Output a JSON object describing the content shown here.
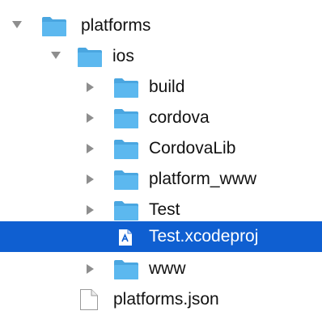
{
  "tree": {
    "items": [
      {
        "label": "platforms",
        "type": "folder",
        "expanded": true
      },
      {
        "label": "ios",
        "type": "folder",
        "expanded": true
      },
      {
        "label": "build",
        "type": "folder",
        "expanded": false
      },
      {
        "label": "cordova",
        "type": "folder",
        "expanded": false
      },
      {
        "label": "CordovaLib",
        "type": "folder",
        "expanded": false
      },
      {
        "label": "platform_www",
        "type": "folder",
        "expanded": false
      },
      {
        "label": "Test",
        "type": "folder",
        "expanded": false
      },
      {
        "label": "Test.xcodeproj",
        "type": "xcodeproj",
        "selected": true
      },
      {
        "label": "www",
        "type": "folder",
        "expanded": false
      },
      {
        "label": "platforms.json",
        "type": "file"
      }
    ]
  },
  "colors": {
    "selection": "#0f5fd1",
    "folder": "#5cb8ef",
    "folder_tab": "#4aa6e0",
    "disclosure": "#8e8e8e"
  },
  "icons": {
    "expanded": "disclosure-triangle-down-icon",
    "collapsed": "disclosure-triangle-right-icon",
    "folder": "folder-icon",
    "file": "document-icon",
    "project": "xcode-project-icon"
  }
}
